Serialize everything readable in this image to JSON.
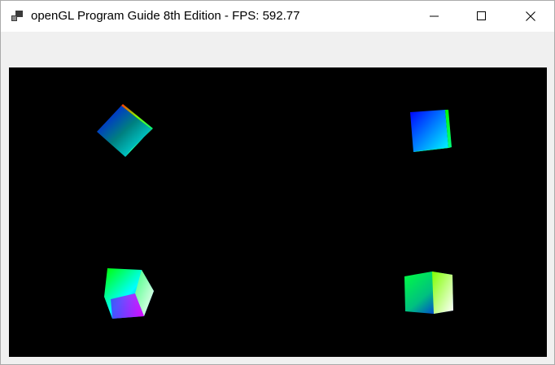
{
  "window": {
    "title": "openGL Program Guide 8th Edition - FPS: 592.77",
    "app_icon": "application-window-icon",
    "controls": {
      "minimize_icon": "minimize-icon",
      "maximize_icon": "maximize-icon",
      "close_icon": "close-icon"
    }
  },
  "viewport": {
    "background": "#000000",
    "cubes": [
      {
        "name": "cube-top-left",
        "colors": [
          "#ff0000",
          "#00ff00",
          "#0000ff",
          "#00ffff"
        ]
      },
      {
        "name": "cube-top-right",
        "colors": [
          "#0000ff",
          "#00ff00",
          "#00ffff",
          "#00ff80"
        ]
      },
      {
        "name": "cube-bottom-left",
        "colors": [
          "#00ff00",
          "#00ffff",
          "#ff00ff",
          "#0000ff",
          "#ffffff"
        ]
      },
      {
        "name": "cube-bottom-right",
        "colors": [
          "#00ff00",
          "#00ffff",
          "#0000ff",
          "#80ff00",
          "#ffffff"
        ]
      }
    ]
  }
}
